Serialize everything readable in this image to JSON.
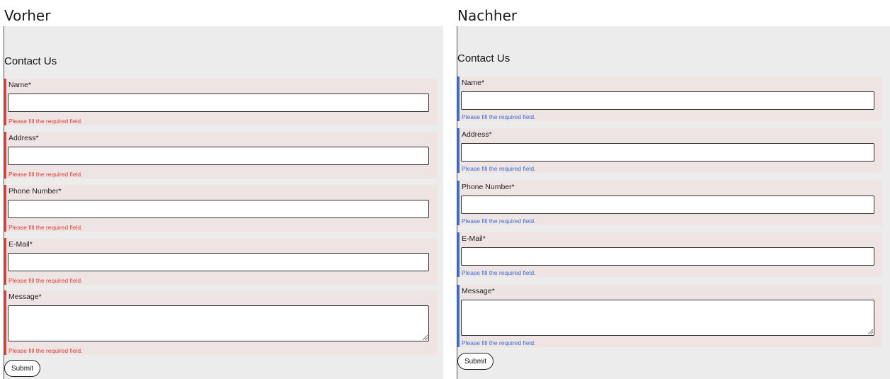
{
  "captions": {
    "before": "Vorher",
    "after": "Nachher"
  },
  "colors": {
    "error_before": "#d9423a",
    "error_after": "#3a6fd6",
    "panel_background": "#ececec",
    "field_background": "#ede4e3"
  },
  "form": {
    "title": "Contact Us",
    "fields": [
      {
        "label": "Name*",
        "value": "",
        "error": "Please fill the required field."
      },
      {
        "label": "Address*",
        "value": "",
        "error": "Please fill the required field."
      },
      {
        "label": "Phone Number*",
        "value": "",
        "error": "Please fill the required field."
      },
      {
        "label": "E-Mail*",
        "value": "",
        "error": "Please fill the required field."
      },
      {
        "label": "Message*",
        "value": "",
        "error": "Please fill the required field."
      }
    ],
    "submit_label": "Submit"
  }
}
